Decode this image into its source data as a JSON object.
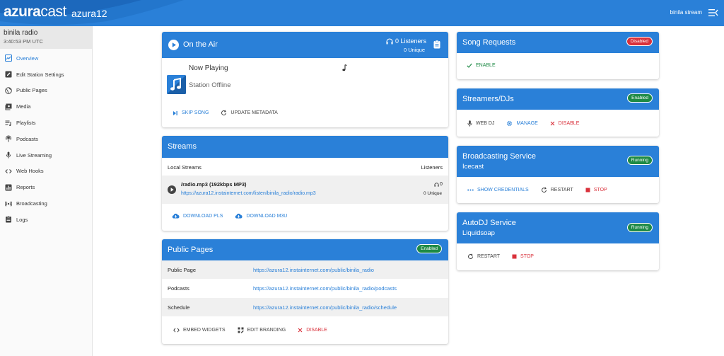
{
  "header": {
    "logo_bold": "azura",
    "logo_light": "cast",
    "instance": "azura12",
    "user": "binila stream"
  },
  "station": {
    "name": "binila radio",
    "time": "3:40:53 PM UTC"
  },
  "sidebar": {
    "items": [
      {
        "label": "Overview",
        "icon": "overview-icon"
      },
      {
        "label": "Edit Station Settings",
        "icon": "edit-icon"
      },
      {
        "label": "Public Pages",
        "icon": "globe-icon"
      },
      {
        "label": "Media",
        "icon": "media-icon"
      },
      {
        "label": "Playlists",
        "icon": "playlist-icon"
      },
      {
        "label": "Podcasts",
        "icon": "podcast-icon"
      },
      {
        "label": "Live Streaming",
        "icon": "mic-icon"
      },
      {
        "label": "Web Hooks",
        "icon": "code-icon"
      },
      {
        "label": "Reports",
        "icon": "reports-icon"
      },
      {
        "label": "Broadcasting",
        "icon": "broadcast-icon"
      },
      {
        "label": "Logs",
        "icon": "logs-icon"
      }
    ]
  },
  "on_air": {
    "title": "On the Air",
    "listeners": "0 Listeners",
    "unique": "0 Unique",
    "now_playing": "Now Playing",
    "status": "Station Offline",
    "skip": "Skip Song",
    "update": "Update Metadata"
  },
  "streams": {
    "title": "Streams",
    "col_local": "Local Streams",
    "col_listeners": "Listeners",
    "stream_name": "/radio.mp3 (192kbps MP3)",
    "stream_url": "https://azura12.instainternet.com/listen/binila_radio/radio.mp3",
    "count": "0",
    "unique": "0 Unique",
    "download_pls": "Download PLS",
    "download_m3u": "Download M3U"
  },
  "public_pages": {
    "title": "Public Pages",
    "badge": "Enabled",
    "rows": [
      {
        "label": "Public Page",
        "url": "https://azura12.instainternet.com/public/binila_radio"
      },
      {
        "label": "Podcasts",
        "url": "https://azura12.instainternet.com/public/binila_radio/podcasts"
      },
      {
        "label": "Schedule",
        "url": "https://azura12.instainternet.com/public/binila_radio/schedule"
      }
    ],
    "embed": "Embed Widgets",
    "branding": "Edit Branding",
    "disable": "Disable"
  },
  "song_requests": {
    "title": "Song Requests",
    "badge": "Disabled",
    "enable": "Enable"
  },
  "streamers": {
    "title": "Streamers/DJs",
    "badge": "Enabled",
    "webdj": "Web DJ",
    "manage": "Manage",
    "disable": "Disable"
  },
  "broadcasting": {
    "title": "Broadcasting Service",
    "sub": "Icecast",
    "badge": "Running",
    "credentials": "Show Credentials",
    "restart": "Restart",
    "stop": "Stop"
  },
  "autodj": {
    "title": "AutoDJ Service",
    "sub": "Liquidsoap",
    "badge": "Running",
    "restart": "Restart",
    "stop": "Stop"
  },
  "colors": {
    "primary": "#2a80d8",
    "success": "#1e8a45",
    "danger": "#d9313b"
  }
}
